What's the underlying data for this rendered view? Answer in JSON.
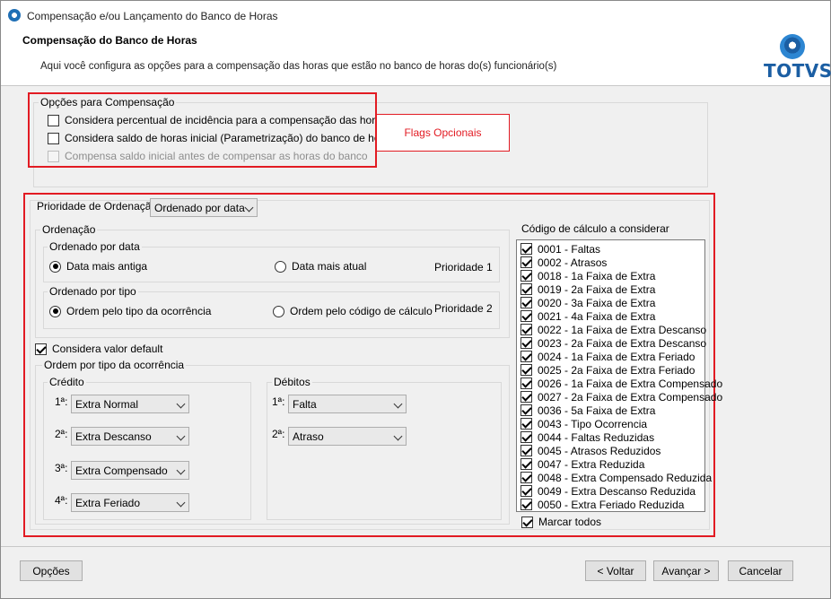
{
  "window": {
    "title": "Compensação e/ou Lançamento do Banco de Horas"
  },
  "header": {
    "title": "Compensação do Banco de Horas",
    "description": "Aqui você configura as opções para a compensação das horas que estão no banco de horas do(s) funcionário(s)",
    "logo_text": "TOTVS"
  },
  "options_group": {
    "label": "Opções para Compensação",
    "items": [
      {
        "label": "Considera percentual de incidência para a compensação das horas",
        "checked": false,
        "enabled": true
      },
      {
        "label": "Considera saldo de horas inicial (Parametrização) do banco de horas",
        "checked": false,
        "enabled": true
      },
      {
        "label": "Compensa saldo inicial antes de compensar as horas do banco",
        "checked": false,
        "enabled": false
      }
    ]
  },
  "annotation": {
    "label": "Flags Opcionais",
    "color": "#e21b23"
  },
  "priority": {
    "label": "Prioridade de Ordenação:",
    "selected": "Ordenado por data"
  },
  "ordering": {
    "label": "Ordenação",
    "by_date": {
      "label": "Ordenado por data",
      "options": [
        {
          "label": "Data mais antiga",
          "selected": true
        },
        {
          "label": "Data mais atual",
          "selected": false
        }
      ],
      "priority": "Prioridade 1"
    },
    "by_type": {
      "label": "Ordenado por tipo",
      "options": [
        {
          "label": "Ordem pelo tipo da ocorrência",
          "selected": true
        },
        {
          "label": "Ordem pelo código de cálculo",
          "selected": false
        }
      ],
      "priority": "Prioridade 2"
    }
  },
  "default_value": {
    "label": "Considera valor default",
    "checked": true
  },
  "occurrence_order": {
    "label": "Ordem por tipo da ocorrência",
    "credit": {
      "label": "Crédito",
      "rows": [
        {
          "prefix": "1ª:",
          "value": "Extra Normal"
        },
        {
          "prefix": "2ª:",
          "value": "Extra Descanso"
        },
        {
          "prefix": "3ª:",
          "value": "Extra Compensado"
        },
        {
          "prefix": "4ª:",
          "value": "Extra Feriado"
        }
      ]
    },
    "debit": {
      "label": "Débitos",
      "rows": [
        {
          "prefix": "1ª:",
          "value": "Falta"
        },
        {
          "prefix": "2ª:",
          "value": "Atraso"
        }
      ]
    }
  },
  "calc_codes": {
    "label": "Código de cálculo a considerar",
    "items": [
      "0001 - Faltas",
      "0002 - Atrasos",
      "0018 - 1a Faixa de Extra",
      "0019 - 2a Faixa de Extra",
      "0020 - 3a Faixa de Extra",
      "0021 - 4a Faixa de Extra",
      "0022 - 1a Faixa de Extra Descanso",
      "0023 - 2a Faixa de Extra Descanso",
      "0024 - 1a Faixa de Extra Feriado",
      "0025 - 2a Faixa de Extra Feriado",
      "0026 - 1a Faixa de Extra Compensado",
      "0027 - 2a Faixa de Extra Compensado",
      "0036 - 5a Faixa de Extra",
      "0043 - Tipo Ocorrencia",
      "0044 - Faltas Reduzidas",
      "0045 - Atrasos Reduzidos",
      "0047 - Extra Reduzida",
      "0048 - Extra Compensado Reduzida",
      "0049 - Extra Descanso Reduzida",
      "0050 - Extra Feriado Reduzida"
    ],
    "select_all_label": "Marcar todos",
    "select_all_checked": true
  },
  "footer": {
    "options_label": "Opções",
    "back_label": "< Voltar",
    "next_label": "Avançar >",
    "cancel_label": "Cancelar"
  }
}
